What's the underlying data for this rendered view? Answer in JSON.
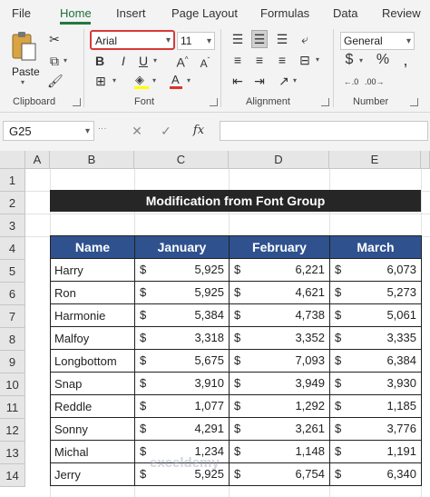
{
  "tabs": [
    "File",
    "Home",
    "Insert",
    "Page Layout",
    "Formulas",
    "Data",
    "Review"
  ],
  "ribbon": {
    "clipboard_label": "Clipboard",
    "paste_label": "Paste",
    "font_label": "Font",
    "alignment_label": "Alignment",
    "number_label": "Number",
    "font_name": "Arial",
    "font_size": "11",
    "number_format": "General",
    "bold": "B",
    "italic": "I",
    "underline": "U"
  },
  "formula_bar": {
    "name_box": "G25",
    "fx": "fx",
    "formula": ""
  },
  "columns": [
    "A",
    "B",
    "C",
    "D",
    "E"
  ],
  "rows": [
    "1",
    "2",
    "3",
    "4",
    "5",
    "6",
    "7",
    "8",
    "9",
    "10",
    "11",
    "12",
    "13",
    "14"
  ],
  "sheet": {
    "title": "Modification from Font Group",
    "headers": [
      "Name",
      "January",
      "February",
      "March"
    ],
    "currency": "$",
    "records": [
      {
        "name": "Harry",
        "jan": "5,925",
        "feb": "6,221",
        "mar": "6,073"
      },
      {
        "name": "Ron",
        "jan": "5,925",
        "feb": "4,621",
        "mar": "5,273"
      },
      {
        "name": "Harmonie",
        "jan": "5,384",
        "feb": "4,738",
        "mar": "5,061"
      },
      {
        "name": "Malfoy",
        "jan": "3,318",
        "feb": "3,352",
        "mar": "3,335"
      },
      {
        "name": "Longbottom",
        "jan": "5,675",
        "feb": "7,093",
        "mar": "6,384"
      },
      {
        "name": "Snap",
        "jan": "3,910",
        "feb": "3,949",
        "mar": "3,930"
      },
      {
        "name": "Reddle",
        "jan": "1,077",
        "feb": "1,292",
        "mar": "1,185"
      },
      {
        "name": "Sonny",
        "jan": "4,291",
        "feb": "3,261",
        "mar": "3,776"
      },
      {
        "name": "Michal",
        "jan": "1,234",
        "feb": "1,148",
        "mar": "1,191"
      },
      {
        "name": "Jerry",
        "jan": "5,925",
        "feb": "6,754",
        "mar": "6,340"
      }
    ]
  },
  "watermark": "exceldemy",
  "colors": {
    "header_fill": "#2f528f",
    "title_fill": "#262626",
    "accent": "#1f7a3f",
    "highlight_border": "#d63a3a"
  }
}
